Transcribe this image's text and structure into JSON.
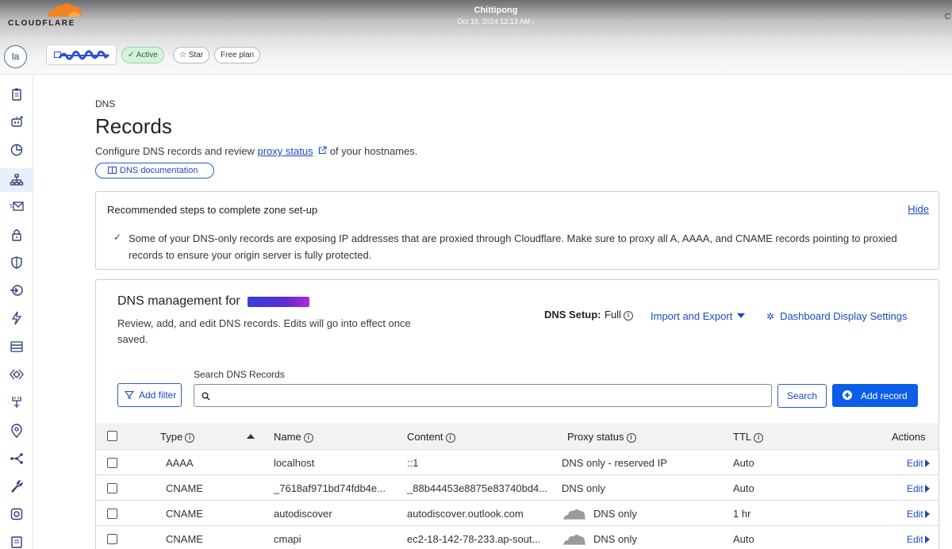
{
  "brand": {
    "logo_text": "CLOUDFLARE",
    "accent": "#f48120"
  },
  "topbar": {
    "account": "Chittipong",
    "datetime": "Oct 19, 2024 12:13 AM",
    "right_char": "C"
  },
  "zonebar": {
    "avatar": "la",
    "pills": {
      "active": "Active",
      "star": "Star",
      "free": "Free plan"
    }
  },
  "sidebar": {
    "icons": [
      "overview-icon",
      "analytics-icon",
      "traffic-icon",
      "dns-icon",
      "email-icon",
      "ssl-icon",
      "security-icon",
      "access-icon",
      "speed-icon",
      "caching-icon",
      "workers-icon",
      "rules-icon",
      "network-icon",
      "traffic-routing-icon",
      "tools-icon",
      "scrape-shield-icon",
      "zaraz-icon"
    ],
    "selected": "dns-icon"
  },
  "page": {
    "breadcrumb": "DNS",
    "title": "Records",
    "desc_before": "Configure DNS records and review ",
    "desc_link": "proxy status",
    "desc_after": " of your hostnames.",
    "doc_button": "DNS documentation"
  },
  "recommend": {
    "title": "Recommended steps to complete zone set-up",
    "hide": "Hide",
    "check": "✓",
    "text": "Some of your DNS-only records are exposing IP addresses that are proxied through Cloudflare. Make sure to proxy all A, AAAA, and CNAME records pointing to proxied records to ensure your origin server is fully protected."
  },
  "management": {
    "title": "DNS management for",
    "subtitle": "Review, add, and edit DNS records. Edits will go into effect once saved.",
    "setup_label": "DNS Setup:",
    "setup_value": "Full",
    "import_export": "Import and Export",
    "dashboard_settings": "Dashboard Display Settings",
    "search_label": "Search DNS Records",
    "search_placeholder": "",
    "add_filter": "Add filter",
    "search_button": "Search",
    "add_record": "Add record"
  },
  "table": {
    "headers": {
      "type": "Type",
      "name": "Name",
      "content": "Content",
      "proxy": "Proxy status",
      "ttl": "TTL",
      "actions": "Actions"
    },
    "rows": [
      {
        "type": "AAAA",
        "name": "localhost",
        "content": "::1",
        "proxy": "DNS only - reserved IP",
        "proxy_icon": false,
        "ttl": "Auto",
        "action": "Edit"
      },
      {
        "type": "CNAME",
        "name": "_7618af971bd74fdb4e...",
        "content": "_88b44453e8875e83740bd4...",
        "proxy": "DNS only",
        "proxy_icon": false,
        "ttl": "Auto",
        "action": "Edit"
      },
      {
        "type": "CNAME",
        "name": "autodiscover",
        "content": "autodiscover.outlook.com",
        "proxy": "DNS only",
        "proxy_icon": true,
        "ttl": "1 hr",
        "action": "Edit"
      },
      {
        "type": "CNAME",
        "name": "cmapi",
        "content": "ec2-18-142-78-233.ap-sout...",
        "proxy": "DNS only",
        "proxy_icon": true,
        "ttl": "Auto",
        "action": "Edit"
      }
    ]
  }
}
